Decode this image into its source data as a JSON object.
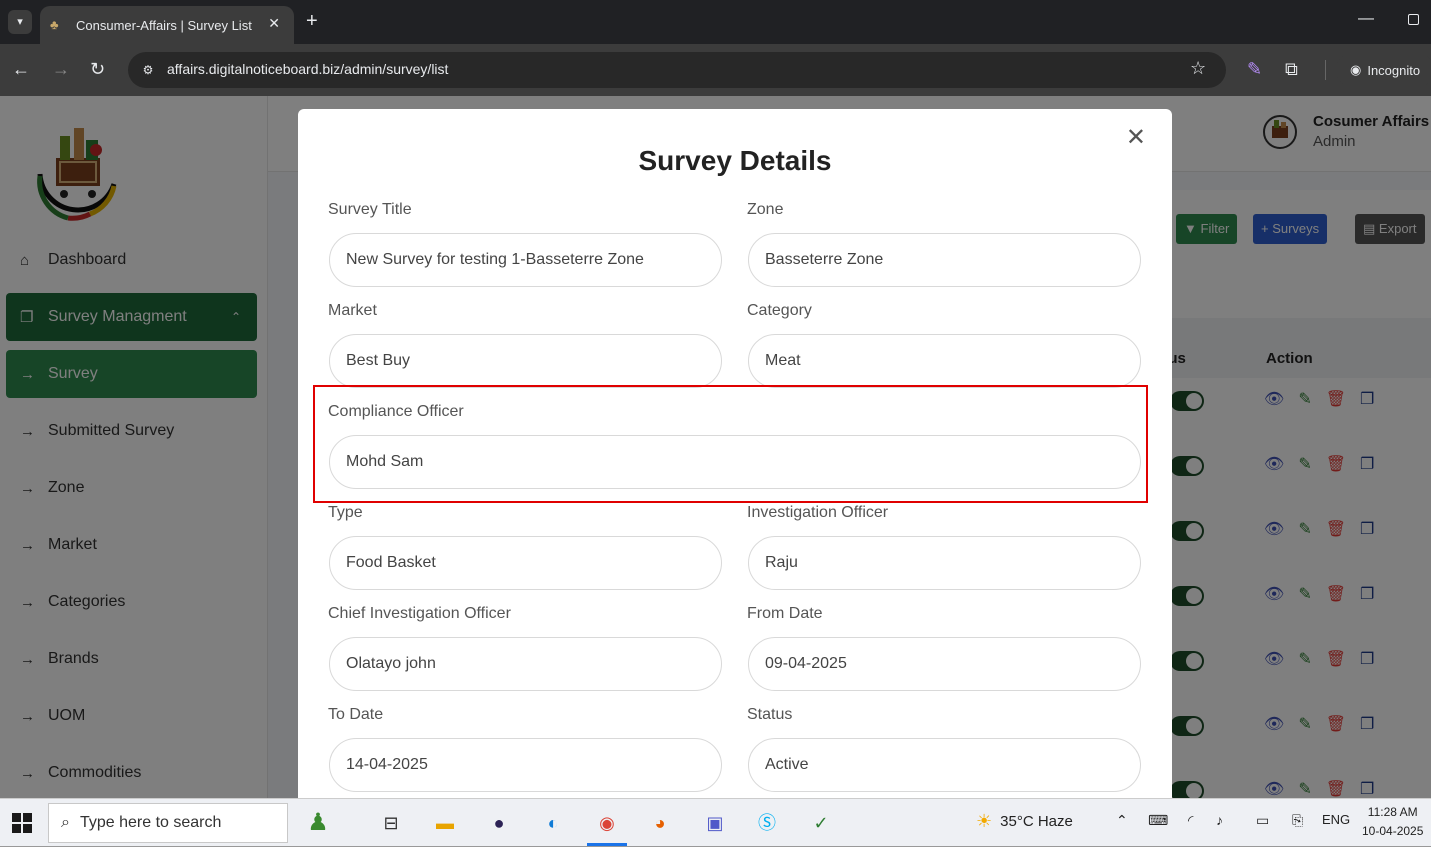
{
  "browser": {
    "tab_title": "Consumer-Affairs | Survey List",
    "url": "affairs.digitalnoticeboard.biz/admin/survey/list",
    "incognito_label": "Incognito"
  },
  "sidebar": {
    "items": [
      {
        "label": "Dashboard",
        "icon": "home-icon"
      },
      {
        "label": "Survey Managment",
        "icon": "copy-icon"
      },
      {
        "label": "Survey",
        "icon": "arrow-right-icon"
      },
      {
        "label": "Submitted Survey",
        "icon": "arrow-right-icon"
      },
      {
        "label": "Zone",
        "icon": "arrow-right-icon"
      },
      {
        "label": "Market",
        "icon": "arrow-right-icon"
      },
      {
        "label": "Categories",
        "icon": "arrow-right-icon"
      },
      {
        "label": "Brands",
        "icon": "arrow-right-icon"
      },
      {
        "label": "UOM",
        "icon": "arrow-right-icon"
      },
      {
        "label": "Commodities",
        "icon": "arrow-right-icon"
      }
    ]
  },
  "header": {
    "user_name": "Cosumer Affairs",
    "user_role": "Admin"
  },
  "list": {
    "filter_label": "Filter",
    "add_label": "+ Surveys",
    "export_label": "Export",
    "col_status": "Status",
    "col_action": "Action",
    "row_count": 7
  },
  "modal": {
    "title": "Survey Details",
    "fields": {
      "survey_title": {
        "label": "Survey Title",
        "value": "New Survey for testing 1-Basseterre Zone"
      },
      "zone": {
        "label": "Zone",
        "value": "Basseterre Zone"
      },
      "market": {
        "label": "Market",
        "value": "Best Buy"
      },
      "category": {
        "label": "Category",
        "value": "Meat"
      },
      "compliance_officer": {
        "label": "Compliance Officer",
        "value": "Mohd Sam"
      },
      "type": {
        "label": "Type",
        "value": "Food Basket"
      },
      "investigation_officer": {
        "label": "Investigation Officer",
        "value": "Raju"
      },
      "chief_investigation_officer": {
        "label": "Chief Investigation Officer",
        "value": "Olatayo john"
      },
      "from_date": {
        "label": "From Date",
        "value": "09-04-2025"
      },
      "to_date": {
        "label": "To Date",
        "value": "14-04-2025"
      },
      "status": {
        "label": "Status",
        "value": "Active"
      }
    }
  },
  "taskbar": {
    "search_placeholder": "Type here to search",
    "weather": "35°C  Haze",
    "language": "ENG",
    "time": "11:28 AM",
    "date": "10-04-2025"
  },
  "colors": {
    "brand_green": "#1e6b3a",
    "active_green": "#2e8b4f",
    "highlight_red": "#e00000"
  }
}
